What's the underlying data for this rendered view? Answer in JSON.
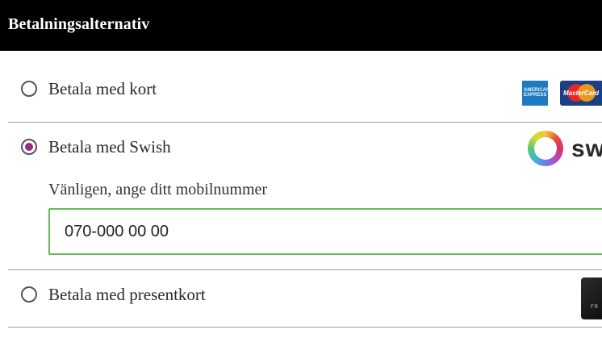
{
  "header": {
    "title": "Betalningsalternativ"
  },
  "payment_options": [
    {
      "label": "Betala med kort",
      "selected": false,
      "logos": [
        "amex-logo",
        "mastercard-logo"
      ]
    },
    {
      "label": "Betala med Swish",
      "selected": true,
      "logos": [
        "swish-logo"
      ]
    },
    {
      "label": "Betala med presentkort",
      "selected": false,
      "logos": [
        "giftcard-image"
      ]
    }
  ],
  "logos": {
    "amex_text": "AMERICAN EXPRESS",
    "mastercard_text": "MasterCard",
    "swish_text": "sw",
    "giftcard_text": "FR"
  },
  "swish": {
    "mobile_label": "Vänligen, ange ditt mobilnummer",
    "mobile_value": "070-000 00 00"
  },
  "colors": {
    "header_bg": "#000000",
    "radio_selected": "#9b2a83",
    "input_border": "#68bb59"
  }
}
